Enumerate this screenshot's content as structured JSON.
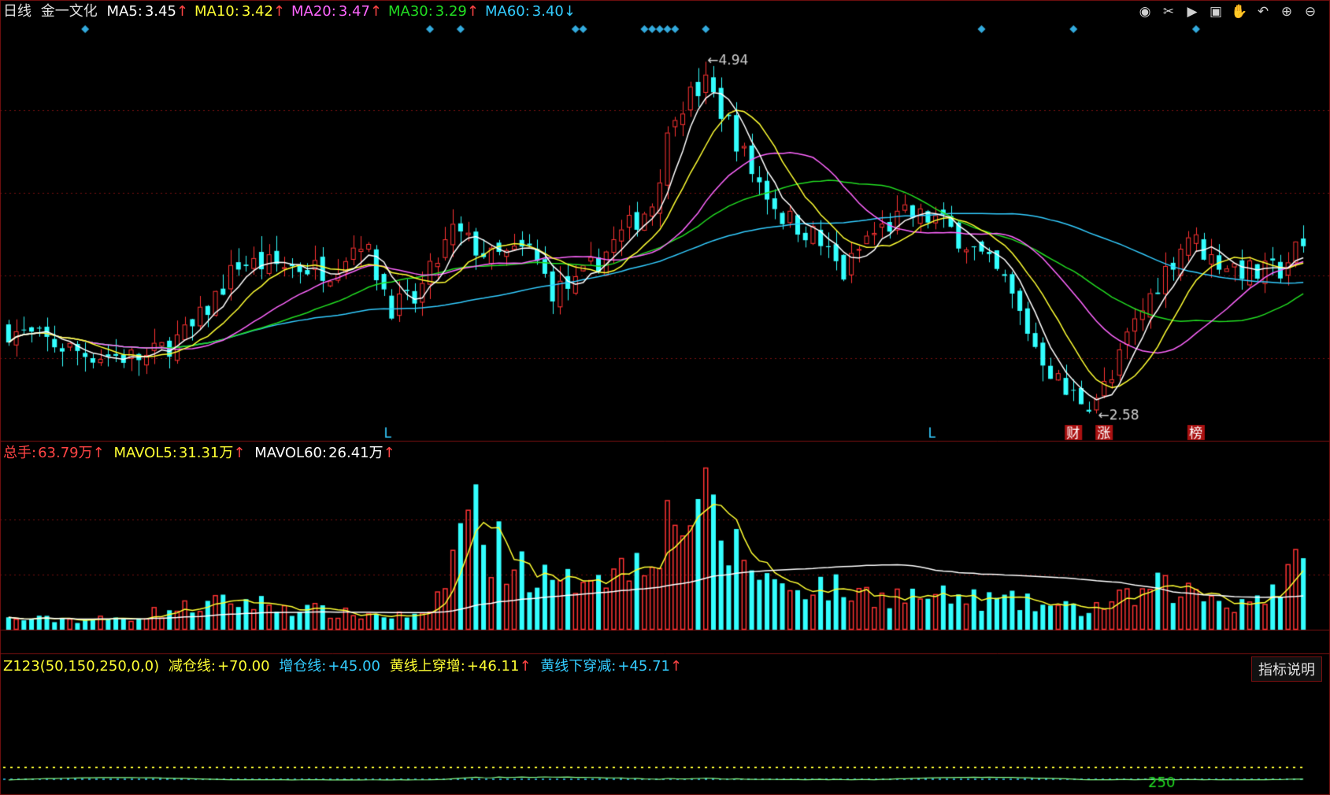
{
  "header": {
    "period": "日线",
    "stock_name": "金一文化",
    "ma": [
      {
        "label": "MA5:",
        "value": "3.45",
        "arrow": "↑",
        "color": "#ffffff"
      },
      {
        "label": "MA10:",
        "value": "3.42",
        "arrow": "↑",
        "color": "#ffff33"
      },
      {
        "label": "MA20:",
        "value": "3.47",
        "arrow": "↑",
        "color": "#ff66ff"
      },
      {
        "label": "MA30:",
        "value": "3.29",
        "arrow": "↑",
        "color": "#22dd22"
      },
      {
        "label": "MA60:",
        "value": "3.40",
        "arrow": "↓",
        "color": "#33ccff"
      }
    ]
  },
  "toolbar_icons": [
    "eye-icon",
    "scissors-icon",
    "play-icon",
    "lock-icon",
    "hand-icon",
    "undo-icon",
    "zoom-in-icon",
    "zoom-out-icon"
  ],
  "volume_header": {
    "total_label": "总手:",
    "total_value": "63.79万",
    "total_arrow": "↑",
    "mavol5_label": "MAVOL5:",
    "mavol5_value": "31.31万",
    "mavol5_arrow": "↑",
    "mavol60_label": "MAVOL60:",
    "mavol60_value": "26.41万",
    "mavol60_arrow": "↑"
  },
  "indicator_header": {
    "name": "Z123(50,150,250,0,0)",
    "reduce_label": "减仓线:",
    "reduce_value": "+70.00",
    "add_label": "增仓线:",
    "add_value": "+45.00",
    "cross_up_label": "黄线上穿增:",
    "cross_up_value": "+46.11",
    "cross_up_arrow": "↑",
    "cross_down_label": "黄线下穿减:",
    "cross_down_value": "+45.71",
    "cross_down_arrow": "↑",
    "explain_button": "指标说明"
  },
  "markers": {
    "high_label": "4.94",
    "low_label": "2.58",
    "l_marks": [
      "L",
      "L"
    ],
    "event_marks": [
      "财",
      "涨",
      "榜"
    ],
    "indicator_value_label": "250"
  },
  "colors": {
    "up": "#ff3333",
    "down": "#33ffff",
    "ma5": "#ffffff",
    "ma10": "#ffff33",
    "ma20": "#ff66ff",
    "ma30": "#22dd22",
    "ma60": "#33ccff",
    "grid": "#7a1010"
  },
  "chart_data": {
    "type": "candlestick",
    "price_anchors": [
      [
        0,
        3.1
      ],
      [
        10,
        2.95
      ],
      [
        18,
        2.92
      ],
      [
        24,
        3.1
      ],
      [
        30,
        3.52
      ],
      [
        37,
        3.5
      ],
      [
        42,
        3.48
      ],
      [
        46,
        3.68
      ],
      [
        50,
        3.25
      ],
      [
        53,
        3.28
      ],
      [
        58,
        3.72
      ],
      [
        63,
        3.55
      ],
      [
        68,
        3.6
      ],
      [
        71,
        3.35
      ],
      [
        74,
        3.38
      ],
      [
        79,
        3.65
      ],
      [
        84,
        3.9
      ],
      [
        87,
        4.5
      ],
      [
        91,
        4.65
      ],
      [
        94,
        4.4
      ],
      [
        97,
        4.1
      ],
      [
        101,
        3.82
      ],
      [
        105,
        3.7
      ],
      [
        109,
        3.45
      ],
      [
        112,
        3.68
      ],
      [
        117,
        3.82
      ],
      [
        121,
        3.8
      ],
      [
        125,
        3.65
      ],
      [
        130,
        3.4
      ],
      [
        134,
        3.0
      ],
      [
        138,
        2.7
      ],
      [
        141,
        2.65
      ],
      [
        144,
        2.78
      ],
      [
        146,
        3.05
      ],
      [
        150,
        3.4
      ],
      [
        154,
        3.7
      ],
      [
        157,
        3.55
      ],
      [
        163,
        3.45
      ],
      [
        166,
        3.48
      ],
      [
        168,
        3.6
      ]
    ],
    "volume_anchors": [
      [
        0,
        0.08
      ],
      [
        14,
        0.08
      ],
      [
        22,
        0.16
      ],
      [
        30,
        0.22
      ],
      [
        44,
        0.12
      ],
      [
        55,
        0.1
      ],
      [
        58,
        0.55
      ],
      [
        60,
        1.0
      ],
      [
        63,
        0.65
      ],
      [
        68,
        0.45
      ],
      [
        72,
        0.3
      ],
      [
        76,
        0.5
      ],
      [
        80,
        0.45
      ],
      [
        86,
        0.8
      ],
      [
        90,
        1.0
      ],
      [
        93,
        0.7
      ],
      [
        97,
        0.5
      ],
      [
        101,
        0.32
      ],
      [
        105,
        0.35
      ],
      [
        110,
        0.28
      ],
      [
        120,
        0.25
      ],
      [
        130,
        0.22
      ],
      [
        140,
        0.15
      ],
      [
        147,
        0.25
      ],
      [
        150,
        0.32
      ],
      [
        155,
        0.28
      ],
      [
        160,
        0.2
      ],
      [
        165,
        0.3
      ],
      [
        168,
        0.45
      ]
    ]
  }
}
